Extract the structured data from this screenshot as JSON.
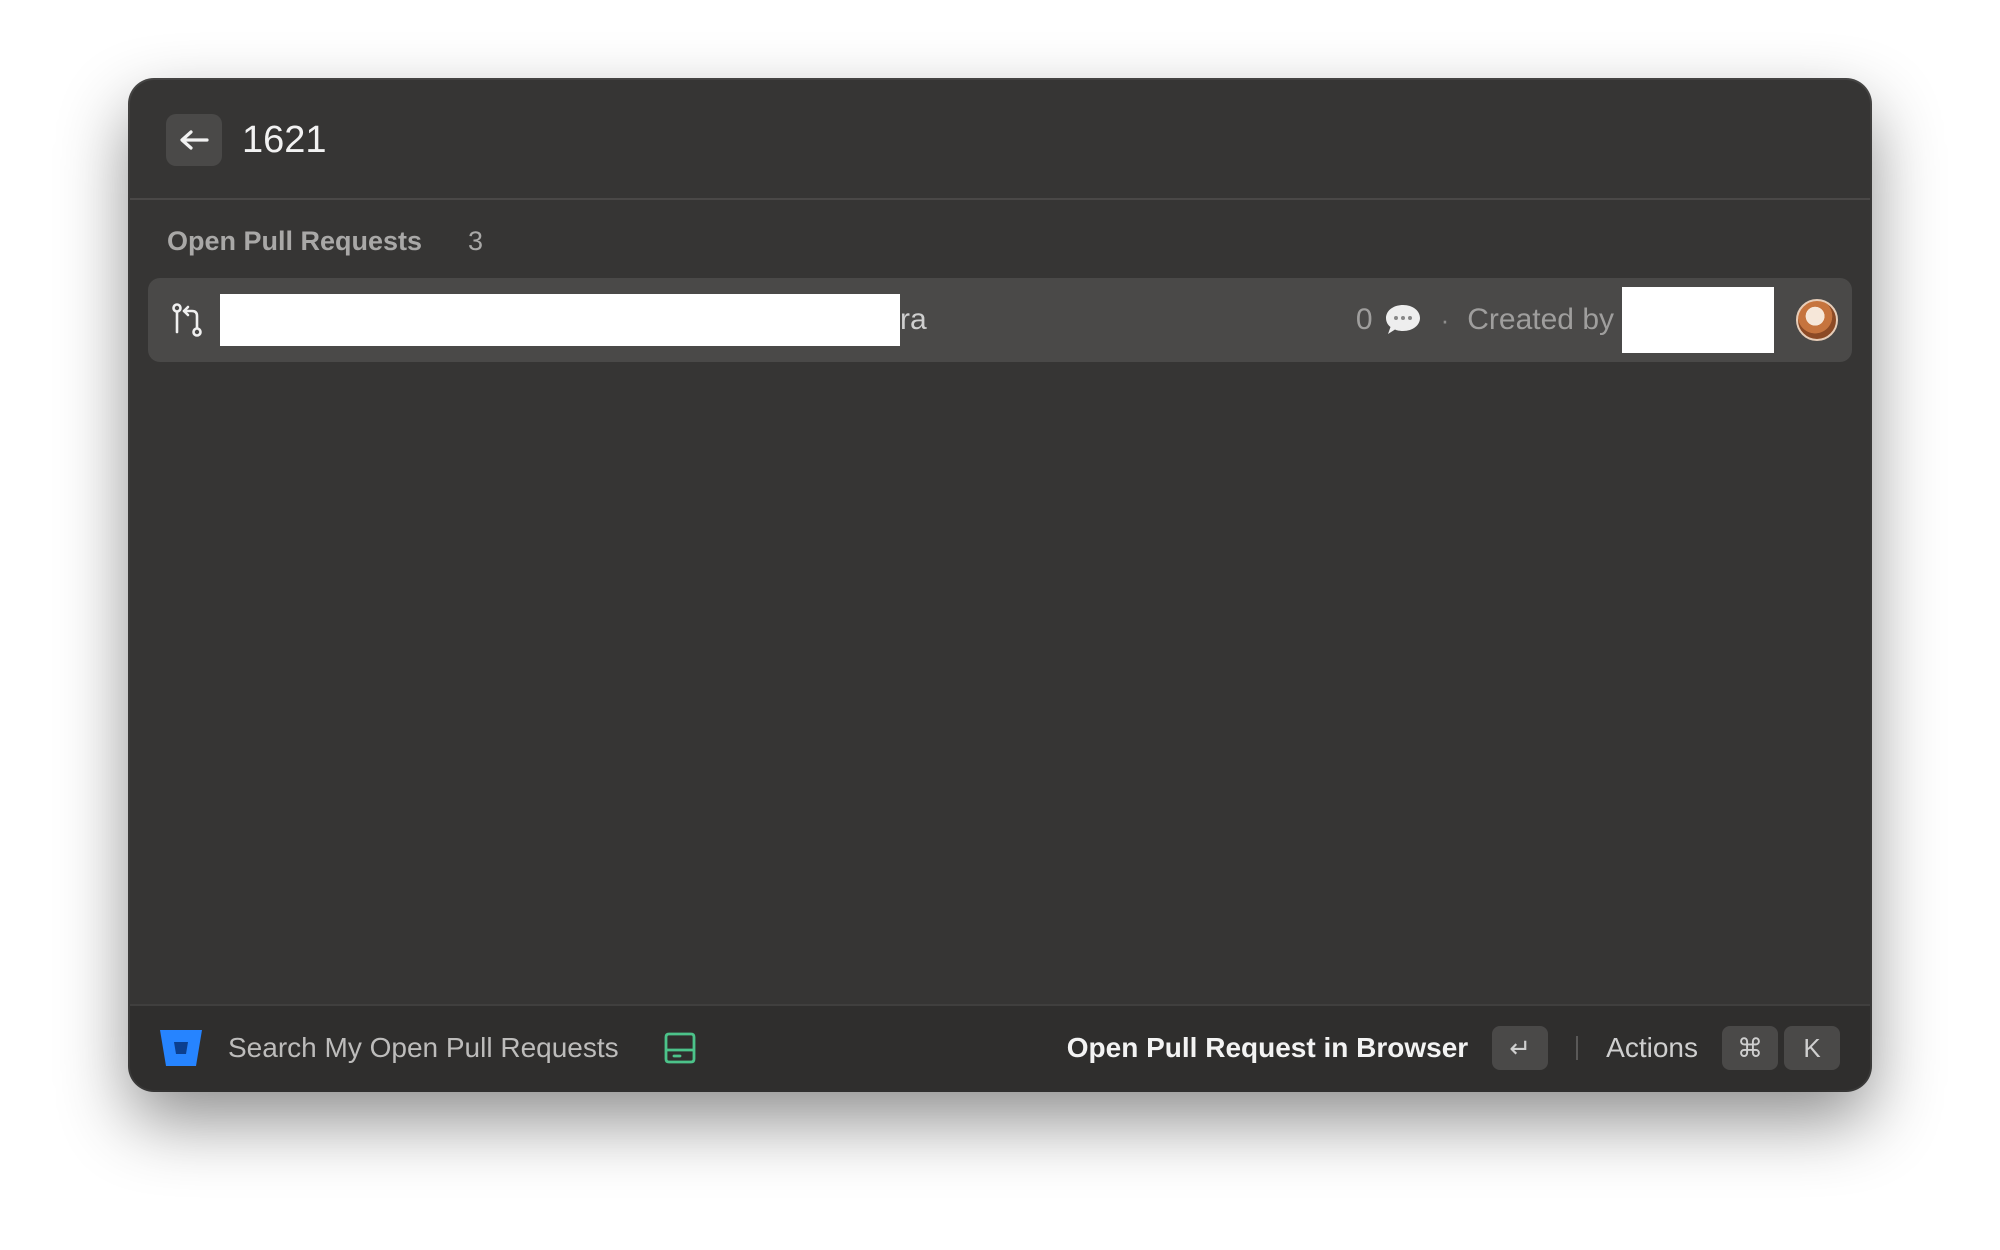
{
  "header": {
    "search_query": "1621"
  },
  "section": {
    "title": "Open Pull Requests",
    "count": "3"
  },
  "rows": [
    {
      "title_visible_suffix": "ra",
      "comment_count": "0",
      "separator": "·",
      "created_by_label": "Created by"
    }
  ],
  "footer": {
    "command_title": "Search My Open Pull Requests",
    "primary_action": "Open Pull Request in Browser",
    "enter_key": "↵",
    "actions_label": "Actions",
    "cmd_key": "⌘",
    "k_key": "K"
  },
  "colors": {
    "window_bg": "#363534",
    "row_selected_bg": "#4a4948",
    "footer_bg": "#2f2e2d",
    "bitbucket_blue": "#2684ff",
    "drive_icon_green": "#4cc38a"
  }
}
